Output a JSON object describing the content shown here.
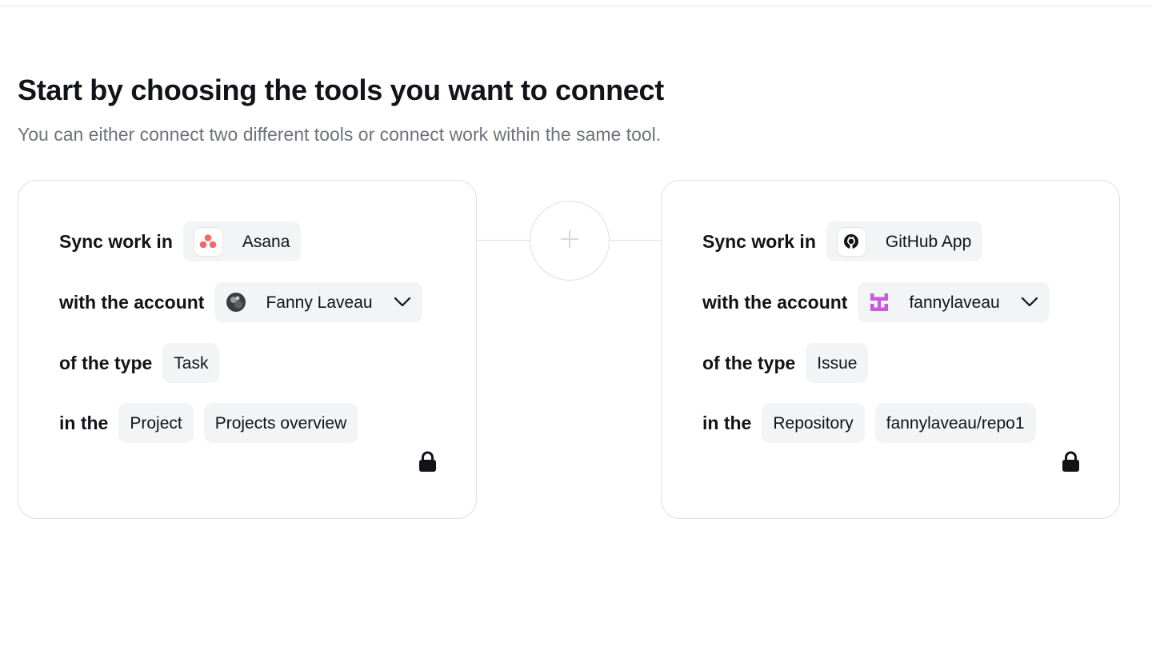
{
  "header": {
    "title": "Start by choosing the tools you want to connect",
    "subtitle": "You can either connect two different tools or connect work within the same tool."
  },
  "left_card": {
    "sync_label": "Sync work in",
    "tool": {
      "name": "Asana",
      "icon": "asana-logo-icon"
    },
    "account_label": "with the account",
    "account": {
      "name": "Fanny Laveau",
      "icon": "user-avatar"
    },
    "type_label": "of the type",
    "type": "Task",
    "in_label": "in the",
    "container_type": "Project",
    "container_value": "Projects overview",
    "lock_icon": "lock-icon"
  },
  "connector": {
    "icon": "plus-icon"
  },
  "right_card": {
    "sync_label": "Sync work in",
    "tool": {
      "name": "GitHub App",
      "icon": "github-logo-icon"
    },
    "account_label": "with the account",
    "account": {
      "name": "fannylaveau",
      "icon": "identicon-avatar"
    },
    "type_label": "of the type",
    "type": "Issue",
    "in_label": "in the",
    "container_type": "Repository",
    "container_value": "fannylaveau/repo1",
    "lock_icon": "lock-icon"
  },
  "colors": {
    "title": "#111318",
    "subtitle": "#6f727a",
    "chip_bg": "#f3f4f6",
    "card_border": "#dedfe3",
    "asana": "#f06a6a",
    "identicon": "#c95bd6"
  }
}
